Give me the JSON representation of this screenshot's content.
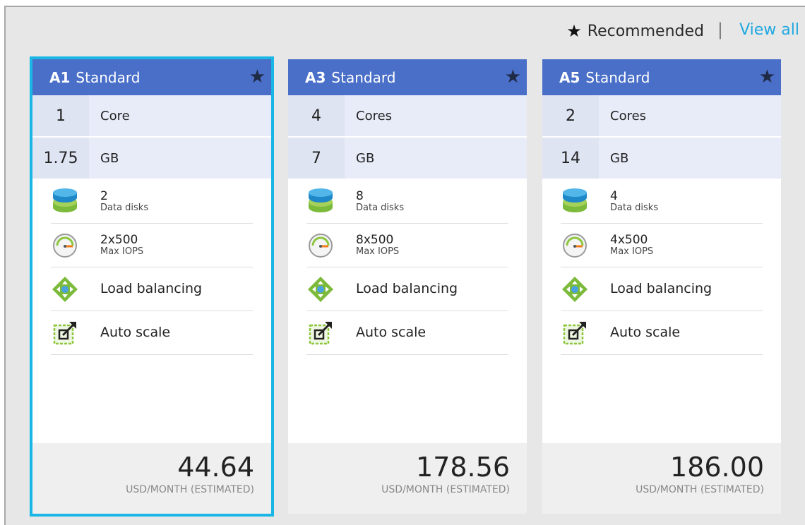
{
  "topbar": {
    "recommended_label": "Recommended",
    "separator": "|",
    "view_all": "View all"
  },
  "icons": {
    "star": "star-icon",
    "disks": "data-disks-icon",
    "iops": "gauge-icon",
    "lb": "load-balancing-icon",
    "autoscale": "auto-scale-icon"
  },
  "colors": {
    "header": "#4a6fc8",
    "selection": "#19b6e6",
    "link": "#1fa8e0"
  },
  "cards": [
    {
      "tier": "A1",
      "name": "Standard",
      "cores_value": "1",
      "cores_label": "Core",
      "memory_value": "1.75",
      "memory_label": "GB",
      "disks_value": "2",
      "disks_label": "Data disks",
      "iops_value": "2x500",
      "iops_label": "Max IOPS",
      "load_balancing": "Load balancing",
      "auto_scale": "Auto scale",
      "price": "44.64",
      "price_unit": "USD/MONTH (ESTIMATED)",
      "selected": true
    },
    {
      "tier": "A3",
      "name": "Standard",
      "cores_value": "4",
      "cores_label": "Cores",
      "memory_value": "7",
      "memory_label": "GB",
      "disks_value": "8",
      "disks_label": "Data disks",
      "iops_value": "8x500",
      "iops_label": "Max IOPS",
      "load_balancing": "Load balancing",
      "auto_scale": "Auto scale",
      "price": "178.56",
      "price_unit": "USD/MONTH (ESTIMATED)",
      "selected": false
    },
    {
      "tier": "A5",
      "name": "Standard",
      "cores_value": "2",
      "cores_label": "Cores",
      "memory_value": "14",
      "memory_label": "GB",
      "disks_value": "4",
      "disks_label": "Data disks",
      "iops_value": "4x500",
      "iops_label": "Max IOPS",
      "load_balancing": "Load balancing",
      "auto_scale": "Auto scale",
      "price": "186.00",
      "price_unit": "USD/MONTH (ESTIMATED)",
      "selected": false
    }
  ]
}
